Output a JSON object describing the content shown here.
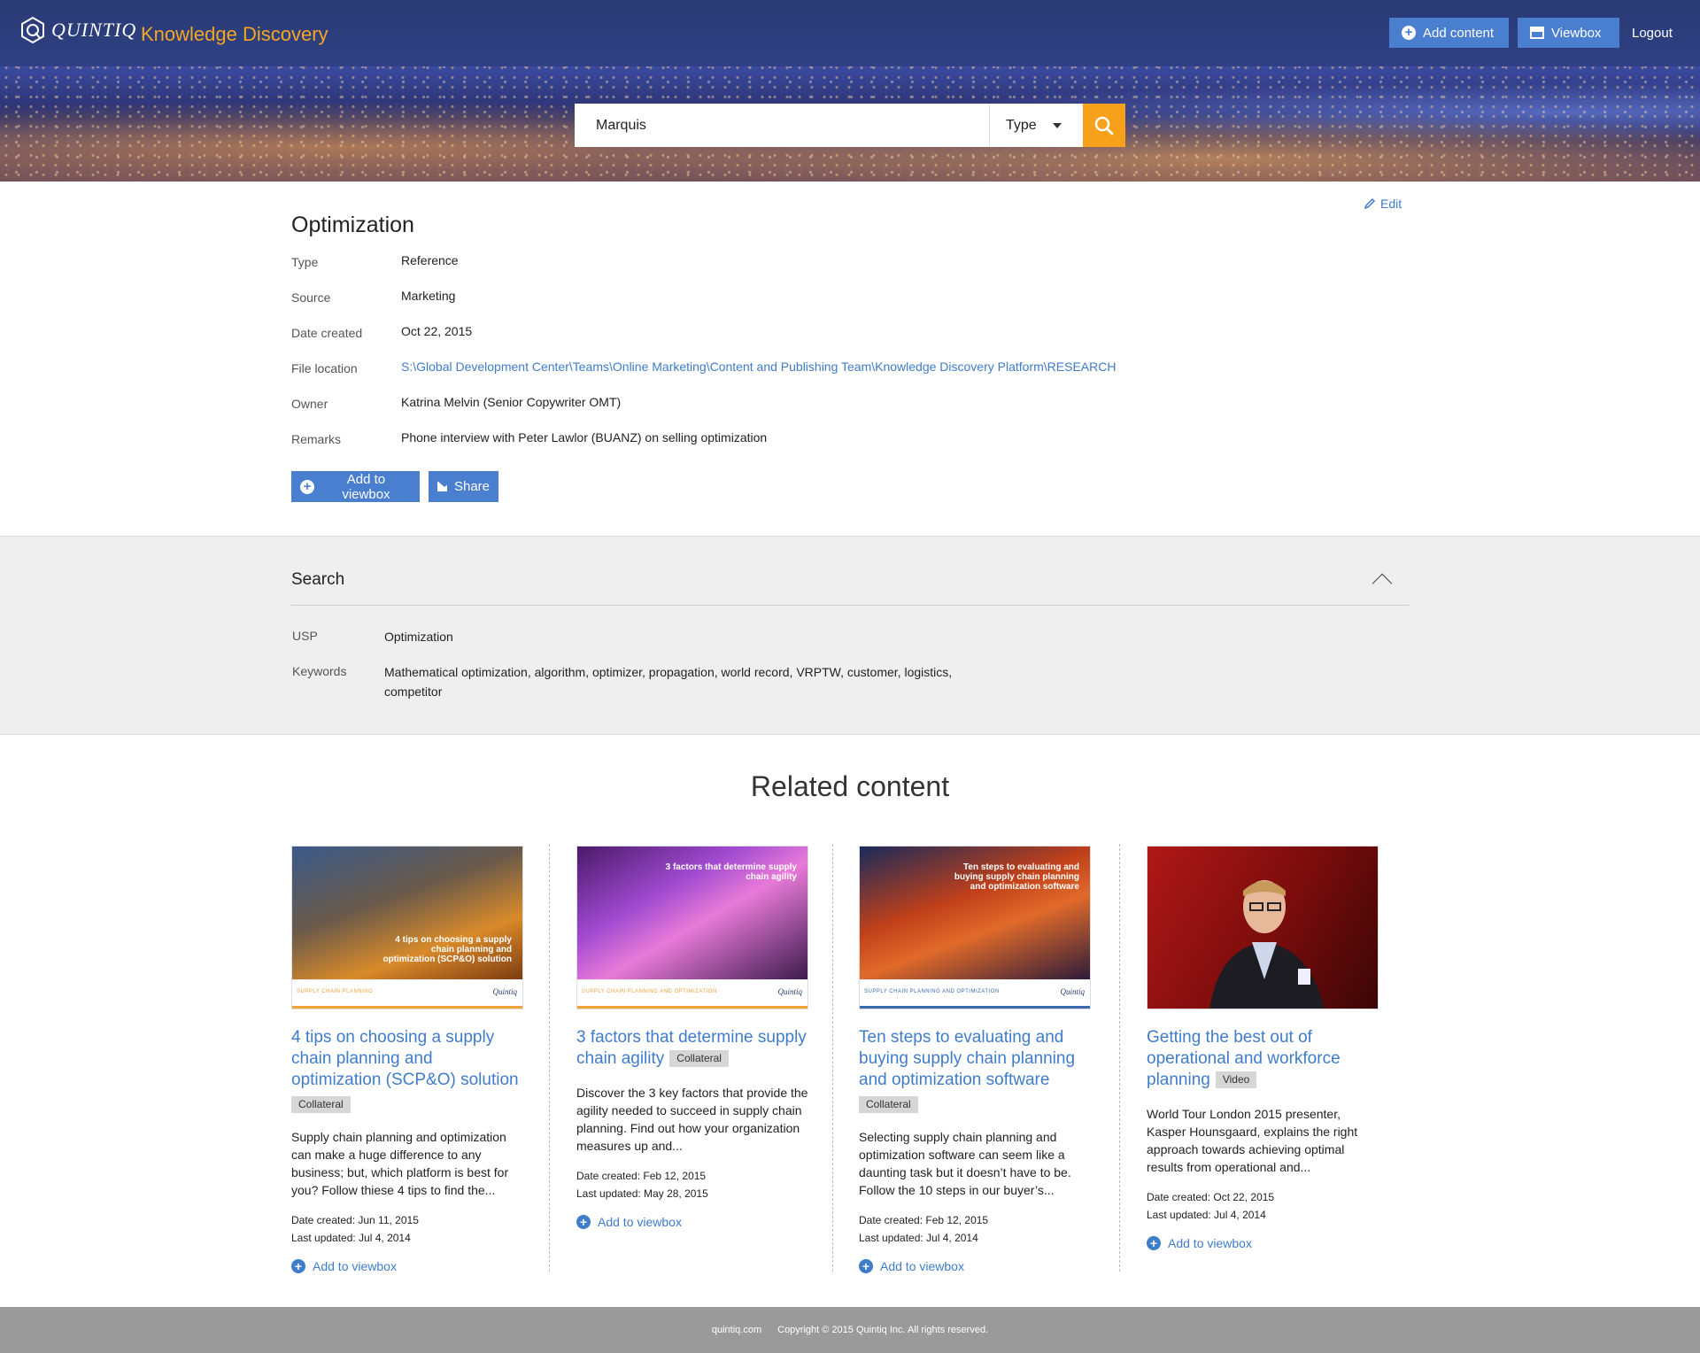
{
  "header": {
    "logo_text": "QUINTIQ",
    "app_title": "Knowledge Discovery",
    "add_content_label": "Add content",
    "viewbox_label": "Viewbox",
    "logout_label": "Logout",
    "accent_color": "#f5a623",
    "bar_color": "#2f4183"
  },
  "search": {
    "query": "Marquis",
    "type_label": "Type",
    "button_color": "#f7a11a"
  },
  "details": {
    "edit_label": "Edit",
    "title": "Optimization",
    "fields": [
      {
        "label": "Type",
        "value": "Reference"
      },
      {
        "label": "Source",
        "value": "Marketing"
      },
      {
        "label": "Date created",
        "value": "Oct 22, 2015"
      },
      {
        "label": "File location",
        "value": "S:\\Global Development Center\\Teams\\Online Marketing\\Content and Publishing Team\\Knowledge Discovery Platform\\RESEARCH"
      },
      {
        "label": "Owner",
        "value": "Katrina Melvin (Senior Copywriter OMT)"
      },
      {
        "label": "Remarks",
        "value": "Phone interview with Peter Lawlor (BUANZ) on selling optimization"
      }
    ],
    "add_to_viewbox_label": "Add to viewbox",
    "share_label": "Share"
  },
  "search_panel": {
    "title": "Search",
    "usp_label": "USP",
    "usp_value": "Optimization",
    "keywords_label": "Keywords",
    "keywords_value": "Mathematical optimization, algorithm, optimizer, propagation, world record, VRPTW, customer, logistics, competitor"
  },
  "related": {
    "title": "Related content",
    "cards": [
      {
        "title": "4 tips on choosing a supply chain planning and optimization (SCP&O) solution",
        "tag": "Collateral",
        "thumb_caption": "4 tips on choosing a supply chain planning and optimization (SCP&O) solution",
        "thumb_footer": "Supply chain planning",
        "thumb_logo": "Quintiq",
        "description": "Supply chain planning and optimization can make a huge difference to any business; but, which platform is best for you? Follow thiese 4 tips to find the...",
        "date_created": "Date created: Jun 11, 2015",
        "last_updated": "Last updated: Jul 4, 2014",
        "add_label": "Add to viewbox"
      },
      {
        "title": "3 factors that determine supply chain agility",
        "tag": "Collateral",
        "thumb_caption": "3 factors that determine supply chain agility",
        "thumb_footer": "Supply chain planning and optimization",
        "thumb_logo": "Quintiq",
        "description": "Discover the 3 key factors that provide the agility needed to succeed in supply chain planning. Find out how your organization measures up and...",
        "date_created": "Date created: Feb 12, 2015",
        "last_updated": "Last updated: May 28, 2015",
        "add_label": "Add to viewbox"
      },
      {
        "title": "Ten steps to evaluating and buying supply chain planning and optimization software",
        "tag": "Collateral",
        "thumb_caption": "Ten steps to evaluating and buying supply chain planning and optimization software",
        "thumb_footer": "Supply chain planning and optimization",
        "thumb_logo": "Quintiq",
        "description": "Selecting supply chain planning and optimization software can seem like a daunting task but it doesn’t have to be. Follow the 10 steps in our buyer’s...",
        "date_created": "Date created: Feb 12, 2015",
        "last_updated": "Last updated: Jul 4, 2014",
        "add_label": "Add to viewbox"
      },
      {
        "title": "Getting the best out of operational and workforce planning",
        "tag": "Video",
        "description": "World Tour London 2015 presenter, Kasper Hounsgaard, explains the right approach towards achieving optimal results from operational and...",
        "date_created": "Date created: Oct 22, 2015",
        "last_updated": "Last updated: Jul 4, 2014",
        "add_label": "Add to viewbox"
      }
    ]
  },
  "footer": {
    "site": "quintiq.com",
    "copyright": "Copyright © 2015 Quintiq Inc. All rights reserved."
  }
}
